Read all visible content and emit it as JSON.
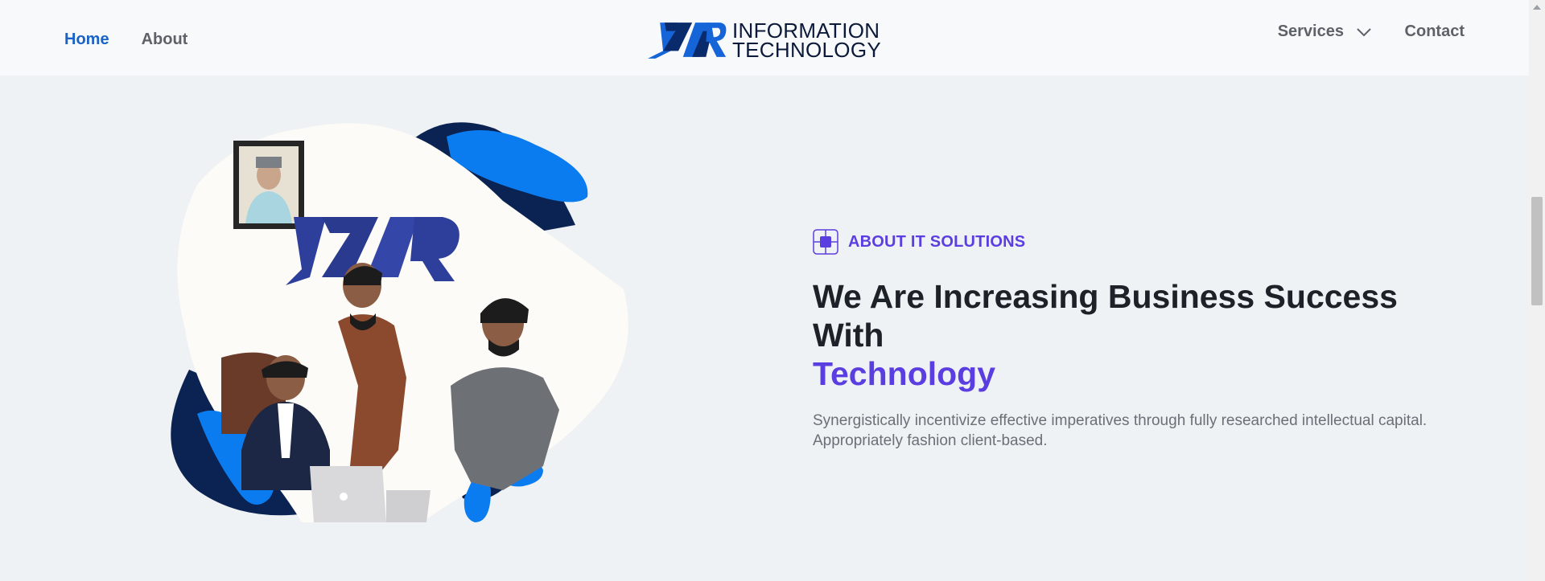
{
  "nav": {
    "home_label": "Home",
    "about_label": "About",
    "services_label": "Services",
    "contact_label": "Contact"
  },
  "logo": {
    "mark": "JZAR",
    "line1": "INFORMATION",
    "line2": "TECHNOLOGY"
  },
  "hero": {
    "eyebrow": "ABOUT IT SOLUTIONS",
    "headline": "We Are Increasing Business Success With",
    "headline_accent": "Technology",
    "description": "Synergistically incentivize effective imperatives through fully researched intellectual capital. Appropriately fashion client-based."
  },
  "colors": {
    "accent": "#5b3ee0",
    "nav_active": "#1a63c6",
    "navy": "#0a2352",
    "blue": "#0b7cf0"
  }
}
